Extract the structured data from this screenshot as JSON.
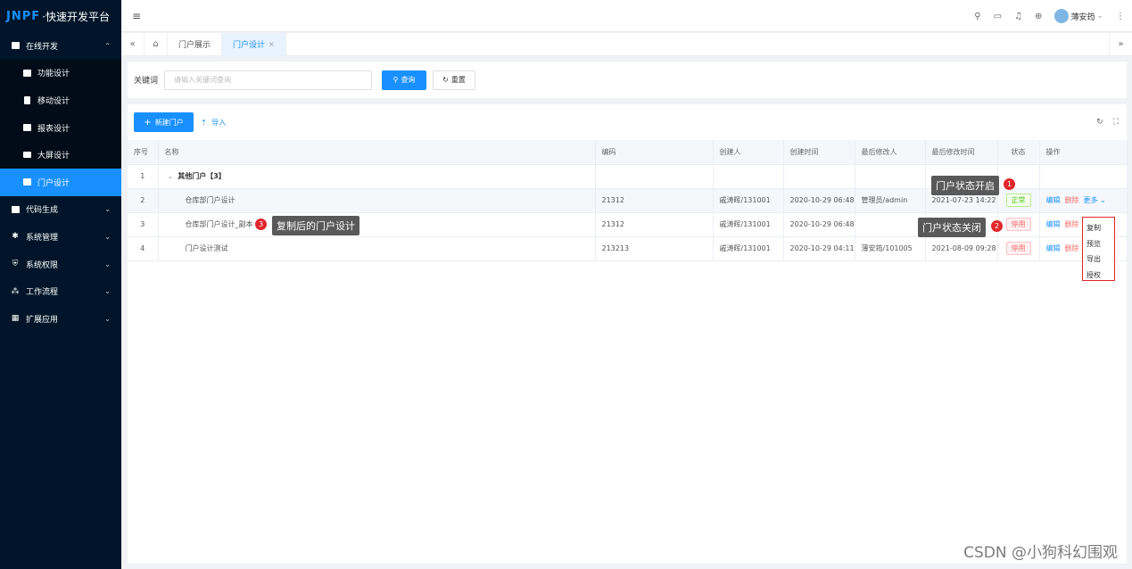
{
  "app": {
    "logo_brand": "JNPF",
    "logo_sub": "·快速开发平台"
  },
  "sidebar": {
    "items": [
      {
        "label": "在线开发",
        "icon": "dev-icon",
        "chev": "⌃"
      },
      {
        "label": "功能设计",
        "icon": "form-icon"
      },
      {
        "label": "移动设计",
        "icon": "mobile-icon"
      },
      {
        "label": "报表设计",
        "icon": "report-icon"
      },
      {
        "label": "大屏设计",
        "icon": "screen-icon"
      },
      {
        "label": "门户设计",
        "icon": "portal-icon"
      },
      {
        "label": "代码生成",
        "icon": "code-icon",
        "chev": "⌄"
      },
      {
        "label": "系统管理",
        "icon": "settings-icon",
        "chev": "⌄"
      },
      {
        "label": "系统权限",
        "icon": "shield-icon",
        "chev": "⌄"
      },
      {
        "label": "工作流程",
        "icon": "flow-icon",
        "chev": "⌄"
      },
      {
        "label": "扩展应用",
        "icon": "grid-icon",
        "chev": "⌄"
      }
    ]
  },
  "topbar": {
    "user_name": "薄安筠"
  },
  "tabs": {
    "items": [
      {
        "label": "门户展示"
      },
      {
        "label": "门户设计"
      }
    ]
  },
  "search": {
    "label": "关键词",
    "placeholder": "请输入关键词查询",
    "query_label": "查询",
    "reset_label": "重置"
  },
  "toolbar": {
    "new_label": "新建门户",
    "import_label": "导入"
  },
  "table": {
    "headers": [
      "序号",
      "名称",
      "编码",
      "创建人",
      "创建时间",
      "最后修改人",
      "最后修改时间",
      "状态",
      "操作"
    ],
    "group": {
      "index": "1",
      "name": "其他门户【3】"
    },
    "rows": [
      {
        "index": "2",
        "name": "仓库部门户设计",
        "code": "21312",
        "creator": "戚涛晖/131001",
        "created": "2020-10-29 06:48",
        "modifier": "管理员/admin",
        "modified": "2021-07-23 14:22",
        "status": "正常"
      },
      {
        "index": "3",
        "name": "仓库部门户设计_副本",
        "code": "21312",
        "creator": "戚涛晖/131001",
        "created": "2020-10-29 06:48",
        "modifier": "",
        "modified": "",
        "status": "停用"
      },
      {
        "index": "4",
        "name": "门户设计测试",
        "code": "213213",
        "creator": "戚涛晖/131001",
        "created": "2020-10-29 04:11",
        "modifier": "薄安筠/101005",
        "modified": "2021-08-09 09:28",
        "status": "停用"
      }
    ],
    "actions": {
      "edit": "编辑",
      "delete": "删除",
      "more": "更多"
    }
  },
  "dropdown": {
    "items": [
      "复制",
      "预览",
      "导出",
      "授权"
    ]
  },
  "annotations": [
    {
      "num": "1",
      "text": "门户状态开启"
    },
    {
      "num": "2",
      "text": "门户状态关闭"
    },
    {
      "num": "3",
      "text": "复制后的门户设计"
    }
  ],
  "watermark": "CSDN @小狗科幻围观"
}
